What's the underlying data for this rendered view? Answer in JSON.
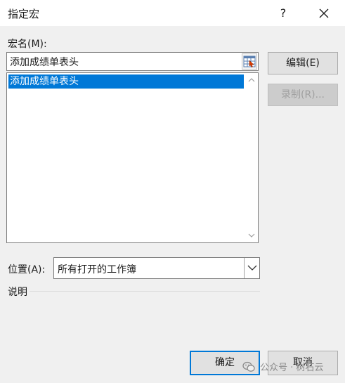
{
  "dialog": {
    "title": "指定宏",
    "help_label": "?",
    "macro_name_label": "宏名(M):",
    "macro_name_value": "添加成绩单表头",
    "macro_list": [
      "添加成绩单表头"
    ],
    "edit_label": "编辑(E)",
    "record_label": "录制(R)...",
    "location_label": "位置(A):",
    "location_value": "所有打开的工作簿",
    "description_label": "说明",
    "ok_label": "确定",
    "cancel_label": "取消"
  },
  "watermark": {
    "text": "公众号 · 树石云"
  },
  "icons": {
    "sheet_picker": "sheet-picker-icon",
    "close": "close-icon",
    "dropdown": "chevron-down-icon",
    "scroll_up": "scroll-up-icon",
    "scroll_down": "scroll-down-icon",
    "wechat": "wechat-icon"
  },
  "colors": {
    "selection": "#0078d7",
    "default_button_border": "#0078d7",
    "dialog_bg": "#f0f0f0"
  }
}
